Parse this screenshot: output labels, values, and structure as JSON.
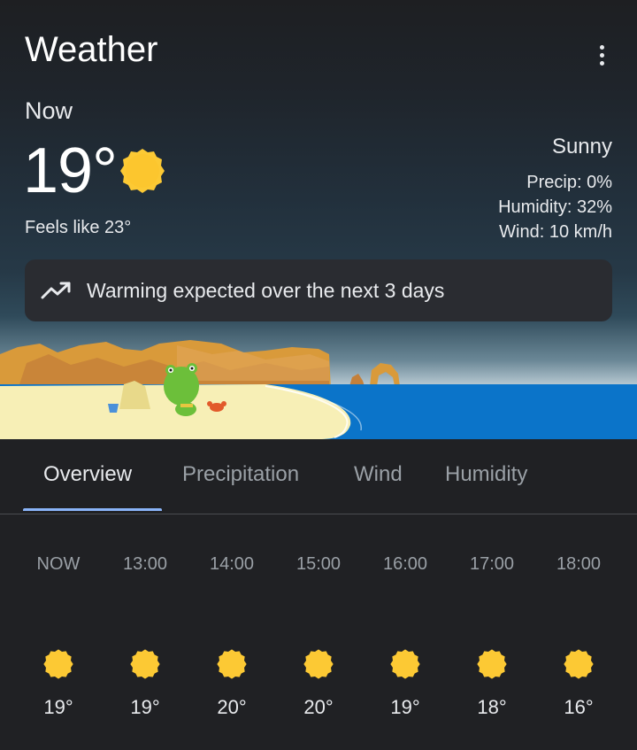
{
  "app": {
    "title": "Weather"
  },
  "current": {
    "label": "Now",
    "temperature": "19°",
    "feels_like": "Feels like 23°",
    "condition": "Sunny",
    "precip": "Precip: 0%",
    "humidity": "Humidity: 32%",
    "wind": "Wind: 10 km/h",
    "icon": "sun-icon"
  },
  "alert": {
    "text": "Warming expected over the next 3 days",
    "icon": "trending-up-icon"
  },
  "tabs": [
    {
      "label": "Overview",
      "active": true
    },
    {
      "label": "Precipitation",
      "active": false
    },
    {
      "label": "Wind",
      "active": false
    },
    {
      "label": "Humidity",
      "active": false
    }
  ],
  "hourly": [
    {
      "time": "NOW",
      "temp": "19°",
      "icon": "sun-icon"
    },
    {
      "time": "13:00",
      "temp": "19°",
      "icon": "sun-icon"
    },
    {
      "time": "14:00",
      "temp": "20°",
      "icon": "sun-icon"
    },
    {
      "time": "15:00",
      "temp": "20°",
      "icon": "sun-icon"
    },
    {
      "time": "16:00",
      "temp": "19°",
      "icon": "sun-icon"
    },
    {
      "time": "17:00",
      "temp": "18°",
      "icon": "sun-icon"
    },
    {
      "time": "18:00",
      "temp": "16°",
      "icon": "sun-icon"
    }
  ],
  "colors": {
    "accent": "#8ab4f8",
    "sun": "#fcc934",
    "sea": "#0b74c9",
    "sand": "#f7efb6"
  }
}
